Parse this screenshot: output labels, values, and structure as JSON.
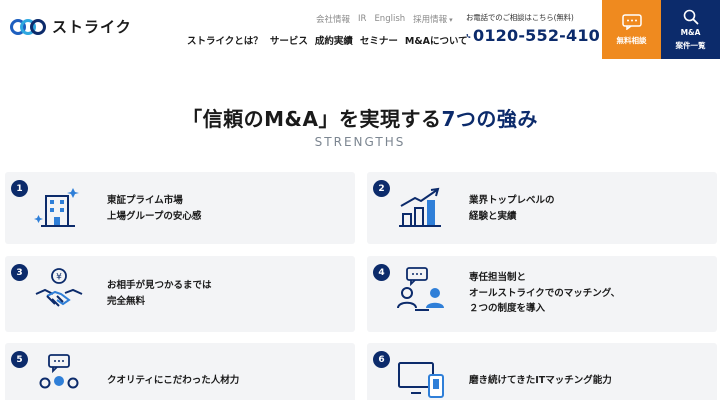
{
  "header": {
    "logo_text": "ストライク",
    "util_nav": [
      {
        "label": "会社情報"
      },
      {
        "label": "IR"
      },
      {
        "label": "English"
      },
      {
        "label": "採用情報"
      }
    ],
    "main_nav": [
      {
        "label": "ストライクとは？"
      },
      {
        "label": "サービス"
      },
      {
        "label": "成約実績"
      },
      {
        "label": "セミナー"
      },
      {
        "label": "M&Aについて"
      }
    ],
    "phone_caption": "お電話でのご相談はこちら(無料)",
    "phone_number": "0120-552-410",
    "consult_label": "無料相談",
    "search_label_1": "M&A",
    "search_label_2": "案件一覧",
    "colors": {
      "accent": "#0c2b6b",
      "orange": "#ef8a1f"
    }
  },
  "section": {
    "title_main": "「信頼のM&A」を実現する",
    "title_accent": "7つの強み",
    "subtitle": "STRENGTHS"
  },
  "cards": [
    {
      "number": "1",
      "icon": "building-icon",
      "lines": [
        "東証プライム市場",
        "上場グループの安心感"
      ]
    },
    {
      "number": "2",
      "icon": "growth-chart-icon",
      "lines": [
        "業界トップレベルの",
        "経験と実績"
      ]
    },
    {
      "number": "3",
      "icon": "handshake-yen-icon",
      "lines": [
        "お相手が見つかるまでは",
        "完全無料"
      ]
    },
    {
      "number": "4",
      "icon": "consultant-meeting-icon",
      "lines": [
        "専任担当制と",
        "オールストライクでのマッチング、",
        "２つの制度を導入"
      ]
    },
    {
      "number": "5",
      "icon": "team-chat-icon",
      "lines": [
        "クオリティにこだわった人材力"
      ]
    },
    {
      "number": "6",
      "icon": "devices-icon",
      "lines": [
        "磨き続けてきたITマッチング能力"
      ]
    }
  ]
}
